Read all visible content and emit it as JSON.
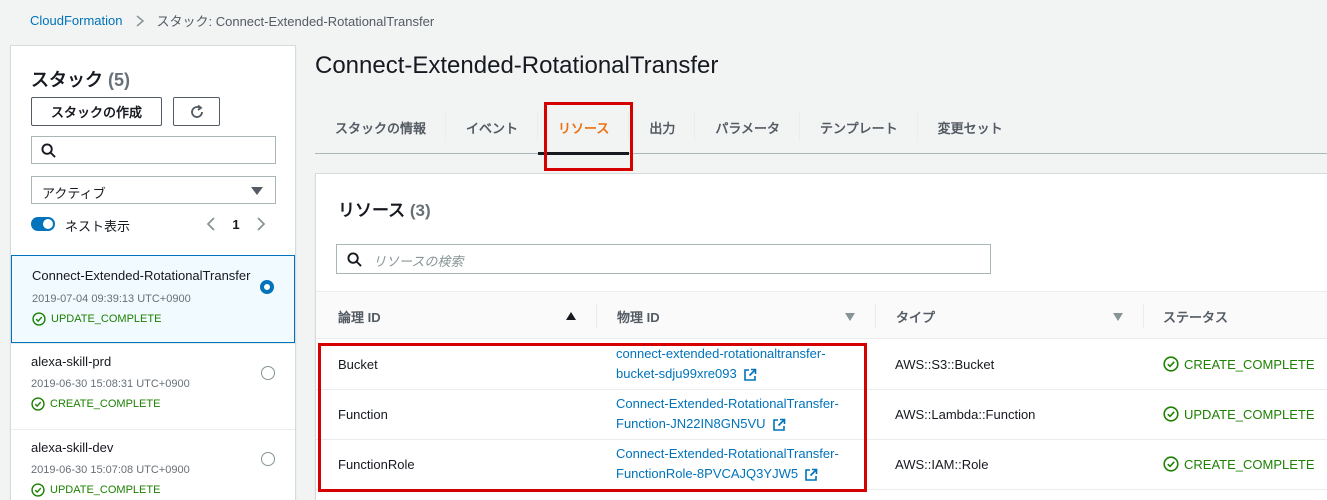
{
  "breadcrumb": {
    "root": "CloudFormation",
    "current": "スタック: Connect-Extended-RotationalTransfer"
  },
  "sidebar": {
    "title": "スタック",
    "count": "(5)",
    "create_button": "スタックの作成",
    "filter_value": "アクティブ",
    "nested_label": "ネスト表示",
    "page": "1",
    "stacks": [
      {
        "name": "Connect-Extended-RotationalTransfer",
        "date": "2019-07-04 09:39:13 UTC+0900",
        "status": "UPDATE_COMPLETE"
      },
      {
        "name": "alexa-skill-prd",
        "date": "2019-06-30 15:08:31 UTC+0900",
        "status": "CREATE_COMPLETE"
      },
      {
        "name": "alexa-skill-dev",
        "date": "2019-06-30 15:07:08 UTC+0900",
        "status": "UPDATE_COMPLETE"
      }
    ]
  },
  "main": {
    "title": "Connect-Extended-RotationalTransfer",
    "tabs": [
      "スタックの情報",
      "イベント",
      "リソース",
      "出力",
      "パラメータ",
      "テンプレート",
      "変更セット"
    ],
    "active_tab": 2
  },
  "resources": {
    "title": "リソース",
    "count": "(3)",
    "search_placeholder": "リソースの検索",
    "columns": [
      "論理 ID",
      "物理 ID",
      "タイプ",
      "ステータス"
    ],
    "rows": [
      {
        "logical": "Bucket",
        "physical_1": "connect-extended-rotationaltransfer-",
        "physical_2": "bucket-sdju99xre093",
        "type": "AWS::S3::Bucket",
        "status": "CREATE_COMPLETE"
      },
      {
        "logical": "Function",
        "physical_1": "Connect-Extended-RotationalTransfer-",
        "physical_2": "Function-JN22IN8GN5VU",
        "type": "AWS::Lambda::Function",
        "status": "UPDATE_COMPLETE"
      },
      {
        "logical": "FunctionRole",
        "physical_1": "Connect-Extended-RotationalTransfer-",
        "physical_2": "FunctionRole-8PVCAJQ3YJW5",
        "type": "AWS::IAM::Role",
        "status": "CREATE_COMPLETE"
      }
    ]
  },
  "colors": {
    "link": "#0073bb",
    "success": "#1d8102",
    "active_tab": "#ec7211",
    "highlight": "#d50000"
  }
}
